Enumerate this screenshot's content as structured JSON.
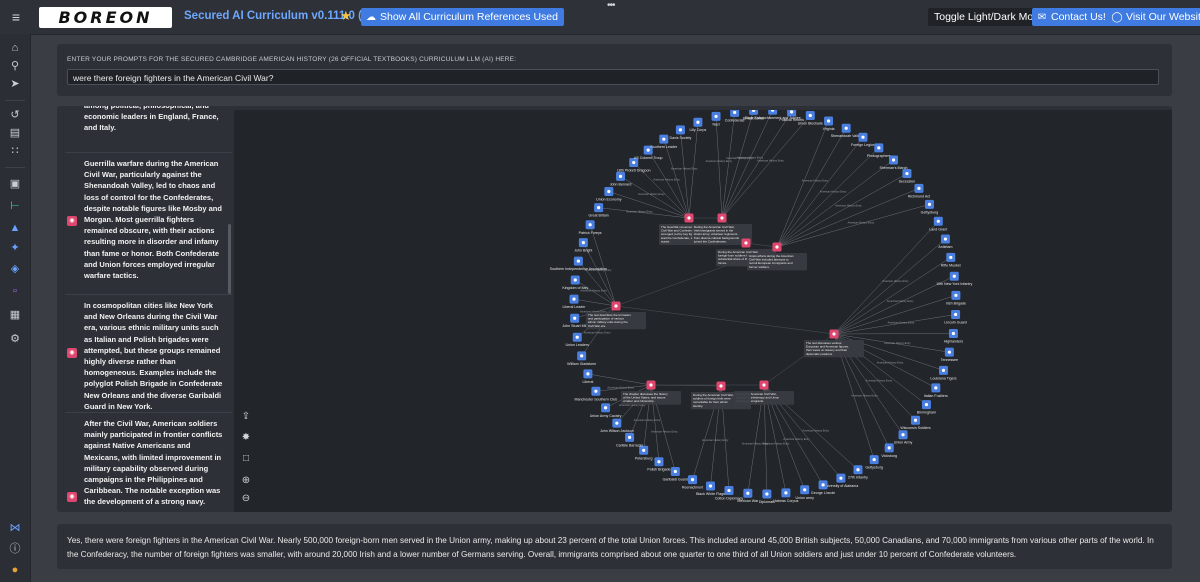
{
  "topbar": {
    "menu_icon": "menu-expand-icon",
    "logo_text": "BOREON",
    "app_title": "Secured AI Curriculum v0.111.0 (beta)",
    "star_icon": "star-icon",
    "show_refs_label": "Show All Curriculum References Used",
    "toggle_theme_label": "Toggle Light/Dark Mode",
    "contact_label": "Contact Us!",
    "website_label": "Visit Our Website"
  },
  "prompt": {
    "label": "ENTER YOUR PROMPTS FOR THE SECURED CAMBRIDGE AMERICAN HISTORY (26 OFFICIAL TEXTBOOKS) CURRICULUM LLM (AI) HERE:",
    "value": "were there foreign fighters in the American Civil War?"
  },
  "results": [
    {
      "text": "among political, philosophical, and economic leaders in England, France, and Italy."
    },
    {
      "text": "Guerrilla warfare during the American Civil War, particularly against the Shenandoah Valley, led to chaos and loss of control for the Confederates, despite notable figures like Mosby and Morgan. Most guerrilla fighters remained obscure, with their actions resulting more in disorder and infamy than fame or honor. Both Confederate and Union forces employed irregular warfare tactics."
    },
    {
      "text": "In cosmopolitan cities like New York and New Orleans during the Civil War era, various ethnic military units such as Italian and Polish brigades were attempted, but these groups remained highly diverse rather than homogeneous. Examples include the polyglot Polish Brigade in Confederate New Orleans and the diverse Garibaldi Guard in New York."
    },
    {
      "text": "After the Civil War, American soldiers mainly participated in frontier conflicts against Native Americans and Mexicans, with limited improvement in military capability observed during campaigns in the Philippines and Caribbean. The notable exception was the development of a strong navy."
    }
  ],
  "graph": {
    "ring_labels": [
      "Black Enfranchisement and Jubilee",
      "Political Rebels",
      "Union Blockade",
      "Virginia",
      "Shenandoah Valley",
      "Foreign Legion",
      "Photographers",
      "Sherman's March",
      "Secession",
      "Richmond Act",
      "Gettysburg",
      "Land Grant",
      "Antietam",
      "Rifle Musket",
      "10th New York Infantry",
      "Irish Brigade",
      "Lincoln Guard",
      "Highlanders",
      "Tennessee",
      "Louisiana Tigers",
      "Italian Fusiliers",
      "Birmingham",
      "Wisconsin Soldiers",
      "Union Army",
      "Vicksburg",
      "Gettysburg",
      "27th Infantry",
      "University of Alabama",
      "George Lincoln",
      "Union army",
      "Habeas Corpus",
      "Diplomats",
      "Mexican War",
      "Cotton Diplomacy",
      "Black White Flags",
      "Reenactment",
      "Garibaldi Guard",
      "Polish Brigade",
      "Petersburg",
      "Carlisle Barracks",
      "John Wilson Jackson",
      "Union Army Cavalry",
      "Manchester Southern Club",
      "Liberal",
      "William Gladstone",
      "Union Leaders",
      "John Stuart Mill",
      "Liberal Leader",
      "Kingdom of Italy",
      "Southern Independence Association",
      "John Bright",
      "Patrick Foreys",
      "Great Britain",
      "Union Economy",
      "John Bernard",
      "18th Pickett Dragoon",
      "US Colored Troop",
      "Southern Leader",
      "Davis Society",
      "Lilly Corps",
      "Nazi",
      "Confederate",
      "Ernest Jones"
    ],
    "edge_label": "American History Entry",
    "center_notes": [
      "The Guerrilla movement of the Civil War and Confederate outlaws emerged, led by key figures to lead the Confederate, strongly stated.",
      "During the American Civil War, Irish immigrants served in the Union army; volunteer regiments from diverse cultural backgrounds joined the Confederates.",
      "During the American Civil War, foreign-born soldiers formed a substantial share of the Union forces.",
      "Union efforts during the American Civil War included attempts to recruit European immigrants and former soldiers.",
      "The text describes the formation and participation of various ethnic military units during the Civil War era.",
      "The text discusses various European and American figures, their views on slavery and their diplomatic positions.",
      "During the American Civil War, both the Confederacy and Union recruited immigrants.",
      "The chapter discusses the history of the United States, and issues of labor and citizenship.",
      "During the American Civil War, soldiers of foreign birth were remarkable for their ethnic identity."
    ]
  },
  "tools": [
    "export-icon",
    "spread-icon",
    "fit-icon",
    "zoom-in-icon",
    "zoom-out-icon"
  ],
  "answer": {
    "text": "Yes, there were foreign fighters in the American Civil War. Nearly 500,000 foreign-born men served in the Union army, making up about 23 percent of the total Union forces. This included around 45,000 British subjects, 50,000 Canadians, and 70,000 immigrants from various other parts of the world. In the Confederacy, the number of foreign fighters was smaller, with around 20,000 Irish and a lower number of Germans serving. Overall, immigrants comprised about one quarter to one third of all Union soldiers and just under 10 percent of Confederate volunteers."
  },
  "colors": {
    "accent": "#3f7be0",
    "pin": "#e0476e",
    "node": "#4a7fe0"
  }
}
